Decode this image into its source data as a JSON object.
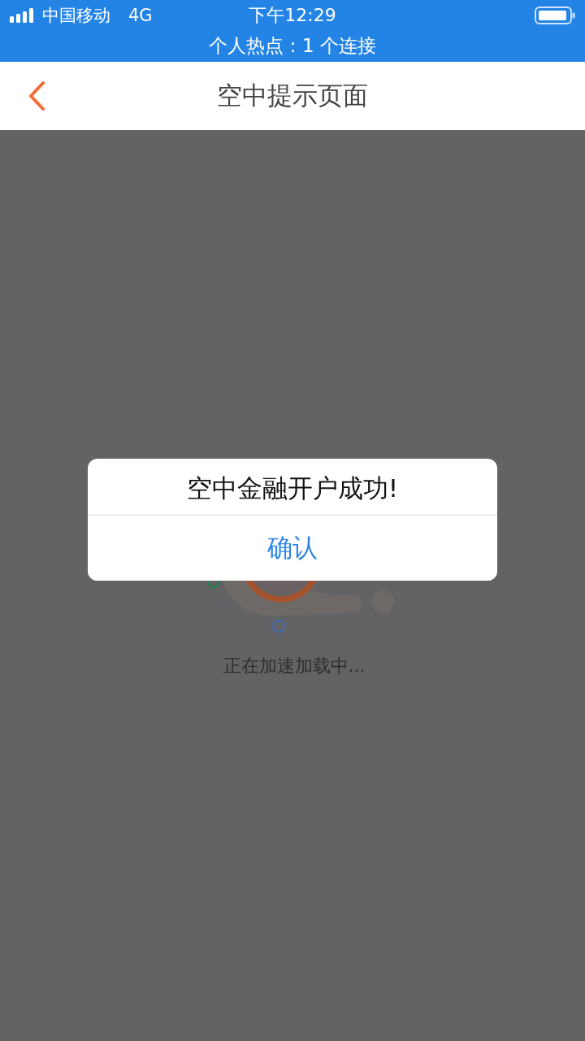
{
  "status_bar": {
    "carrier": "中国移动",
    "network": "4G",
    "time": "下午12:29",
    "hotspot": "个人热点：1 个连接"
  },
  "nav_bar": {
    "title": "空中提示页面"
  },
  "loading": {
    "text": "正在加速加载中..."
  },
  "dialog": {
    "message": "空中金融开户成功!",
    "buttons": [
      "确认"
    ]
  }
}
